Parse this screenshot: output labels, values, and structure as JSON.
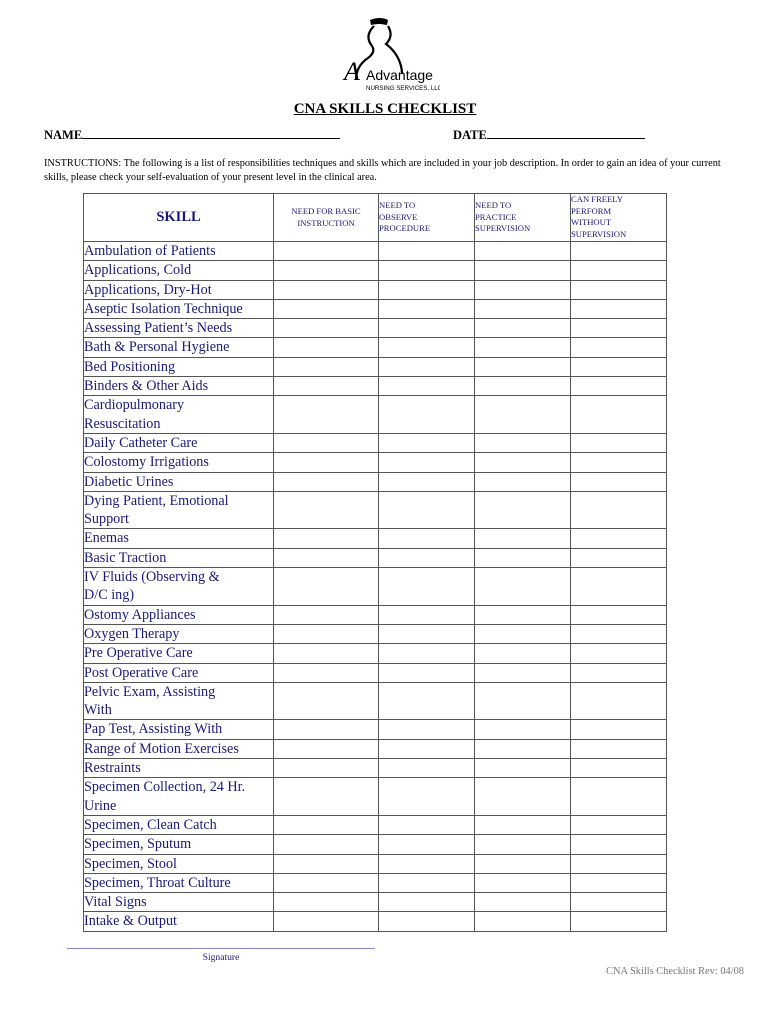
{
  "logo": {
    "brand_name": "Advantage",
    "brand_subtitle": "NURSING SERVICES, LLC"
  },
  "title": "CNA SKILLS CHECKLIST",
  "fields": {
    "name_label": "NAME",
    "date_label": "DATE"
  },
  "instructions": "INSTRUCTIONS:  The following is a list of responsibilities techniques and skills which are included in your job description.  In order to gain an idea of your current skills, please check your self-evaluation of your present level in the clinical area.",
  "table": {
    "headers": [
      "SKILL",
      "NEED FOR BASIC INSTRUCTION",
      "NEED TO OBSERVE PROCEDURE",
      "NEED TO PRACTICE SUPERVISION",
      "CAN FREELY PERFORM WITHOUT SUPERVISION"
    ],
    "header_lines": {
      "c1": [
        "NEED FOR BASIC",
        "INSTRUCTION"
      ],
      "c2": [
        "NEED TO",
        "OBSERVE",
        "PROCEDURE"
      ],
      "c3": [
        "NEED TO",
        "PRACTICE",
        "SUPERVISION"
      ],
      "c4": [
        "CAN FREELY",
        "PERFORM",
        "WITHOUT",
        "SUPERVISION"
      ]
    },
    "skills": [
      {
        "lines": [
          "Ambulation of Patients"
        ]
      },
      {
        "lines": [
          "Applications, Cold"
        ]
      },
      {
        "lines": [
          "Applications, Dry-Hot"
        ]
      },
      {
        "lines": [
          "Aseptic Isolation Technique"
        ]
      },
      {
        "lines": [
          "Assessing Patient’s Needs"
        ]
      },
      {
        "lines": [
          "Bath & Personal Hygiene"
        ]
      },
      {
        "lines": [
          "Bed Positioning"
        ]
      },
      {
        "lines": [
          "Binders & Other Aids"
        ]
      },
      {
        "lines": [
          "Cardiopulmonary",
          "Resuscitation"
        ]
      },
      {
        "lines": [
          "Daily Catheter Care"
        ]
      },
      {
        "lines": [
          "Colostomy Irrigations"
        ]
      },
      {
        "lines": [
          "Diabetic Urines"
        ]
      },
      {
        "lines": [
          "Dying Patient, Emotional",
          "Support"
        ]
      },
      {
        "lines": [
          "Enemas"
        ]
      },
      {
        "lines": [
          "Basic Traction"
        ]
      },
      {
        "lines": [
          "IV Fluids (Observing &",
          "D/C ing)"
        ]
      },
      {
        "lines": [
          "Ostomy Appliances"
        ]
      },
      {
        "lines": [
          "Oxygen Therapy"
        ]
      },
      {
        "lines": [
          "Pre Operative Care"
        ]
      },
      {
        "lines": [
          "Post Operative Care"
        ]
      },
      {
        "lines": [
          "Pelvic Exam, Assisting",
          "With"
        ]
      },
      {
        "lines": [
          "Pap Test, Assisting With"
        ]
      },
      {
        "lines": [
          "Range of Motion Exercises"
        ]
      },
      {
        "lines": [
          "Restraints"
        ]
      },
      {
        "lines": [
          "Specimen Collection, 24 Hr.",
          "Urine"
        ]
      },
      {
        "lines": [
          "Specimen, Clean Catch"
        ]
      },
      {
        "lines": [
          "Specimen, Sputum"
        ]
      },
      {
        "lines": [
          "Specimen, Stool"
        ]
      },
      {
        "lines": [
          "Specimen, Throat Culture"
        ]
      },
      {
        "lines": [
          "Vital Signs"
        ]
      },
      {
        "lines": [
          "Intake & Output"
        ]
      }
    ]
  },
  "footer": {
    "signature_label": "Signature",
    "revision": "CNA Skills Checklist Rev: 04/08"
  },
  "colors": {
    "table_text": "#1a1a7a",
    "footer_text": "#777777",
    "signature_line": "#8888cc"
  }
}
